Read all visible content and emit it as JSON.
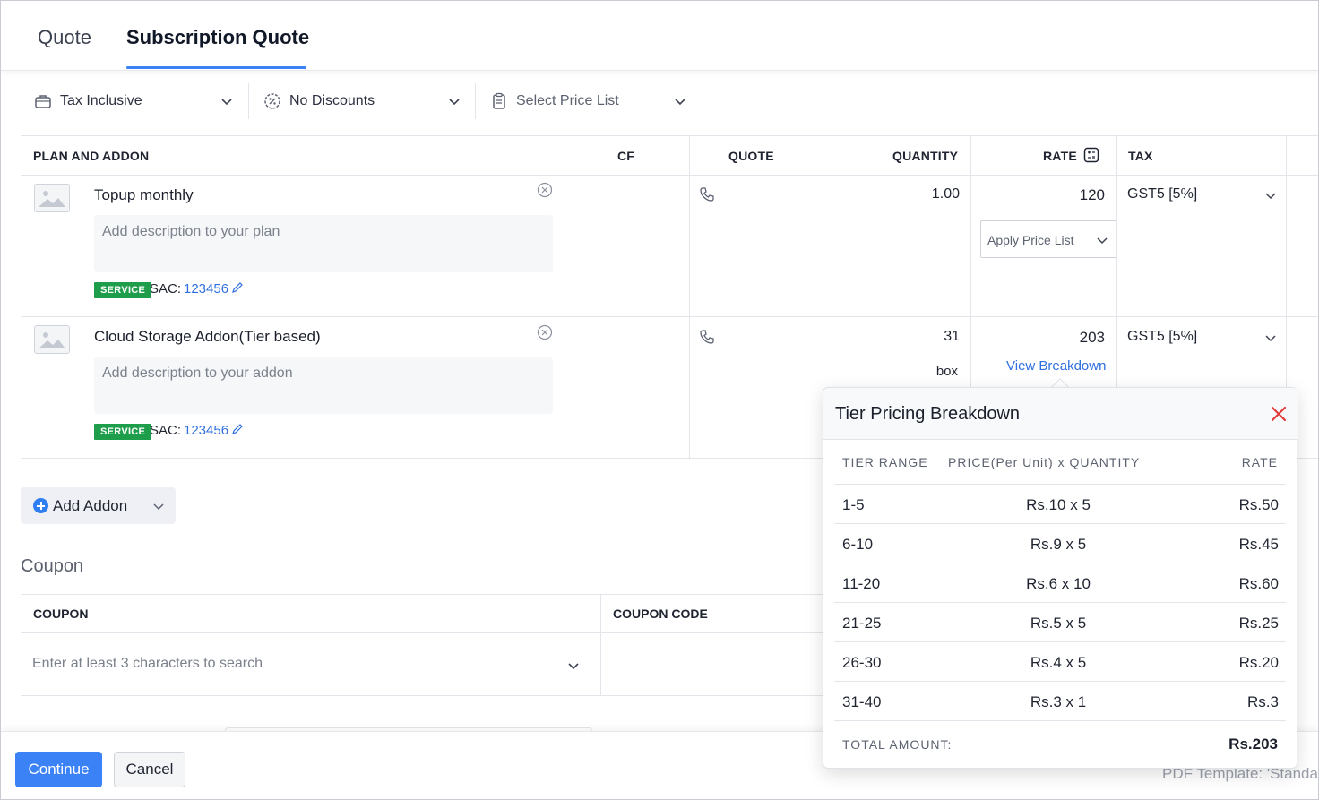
{
  "tabs": [
    {
      "label": "Quote"
    },
    {
      "label": "Subscription Quote"
    }
  ],
  "filters": {
    "tax": "Tax Inclusive",
    "discounts": "No Discounts",
    "price_list": "Select Price List"
  },
  "table": {
    "headers": {
      "plan_addon": "PLAN AND ADDON",
      "cf": "CF",
      "quote": "QUOTE",
      "quantity": "QUANTITY",
      "rate": "RATE",
      "tax": "TAX"
    },
    "rows": [
      {
        "name": "Topup monthly",
        "description_placeholder": "Add description to your plan",
        "badge": "SERVICE",
        "sac_label": "SAC:",
        "sac_value": "123456",
        "quantity": "1.00",
        "unit": "",
        "rate": "120",
        "price_list_select": "Apply Price List",
        "tax": "GST5 [5%]"
      },
      {
        "name": "Cloud Storage Addon(Tier based)",
        "description_placeholder": "Add description to your addon",
        "badge": "SERVICE",
        "sac_label": "SAC:",
        "sac_value": "123456",
        "quantity": "31",
        "unit": "box",
        "rate": "203",
        "breakdown_link": "View Breakdown",
        "tax": "GST5 [5%]"
      }
    ]
  },
  "add_addon": {
    "label": "Add Addon"
  },
  "coupon": {
    "title": "Coupon",
    "col_coupon": "COUPON",
    "col_code": "COUPON CODE",
    "search_placeholder": "Enter at least 3 characters to search"
  },
  "footer": {
    "continue": "Continue",
    "cancel": "Cancel",
    "pdf_template": "PDF Template: 'Standa"
  },
  "popover": {
    "title": "Tier Pricing Breakdown",
    "headers": {
      "range": "TIER RANGE",
      "price": "PRICE(Per Unit)  x  QUANTITY",
      "rate": "RATE"
    },
    "tiers": [
      {
        "range": "1-5",
        "price": "Rs.10  x  5",
        "rate": "Rs.50"
      },
      {
        "range": "6-10",
        "price": "Rs.9  x  5",
        "rate": "Rs.45"
      },
      {
        "range": "11-20",
        "price": "Rs.6  x  10",
        "rate": "Rs.60"
      },
      {
        "range": "21-25",
        "price": "Rs.5  x  5",
        "rate": "Rs.25"
      },
      {
        "range": "26-30",
        "price": "Rs.4  x  5",
        "rate": "Rs.20"
      },
      {
        "range": "31-40",
        "price": "Rs.3  x  1",
        "rate": "Rs.3"
      }
    ],
    "total_label": "TOTAL AMOUNT:",
    "total_value": "Rs.203"
  },
  "colors": {
    "accent": "#3b82f6",
    "link": "#2f6fdf",
    "service_badge": "#1e9e4a",
    "close": "#e23b3b"
  }
}
